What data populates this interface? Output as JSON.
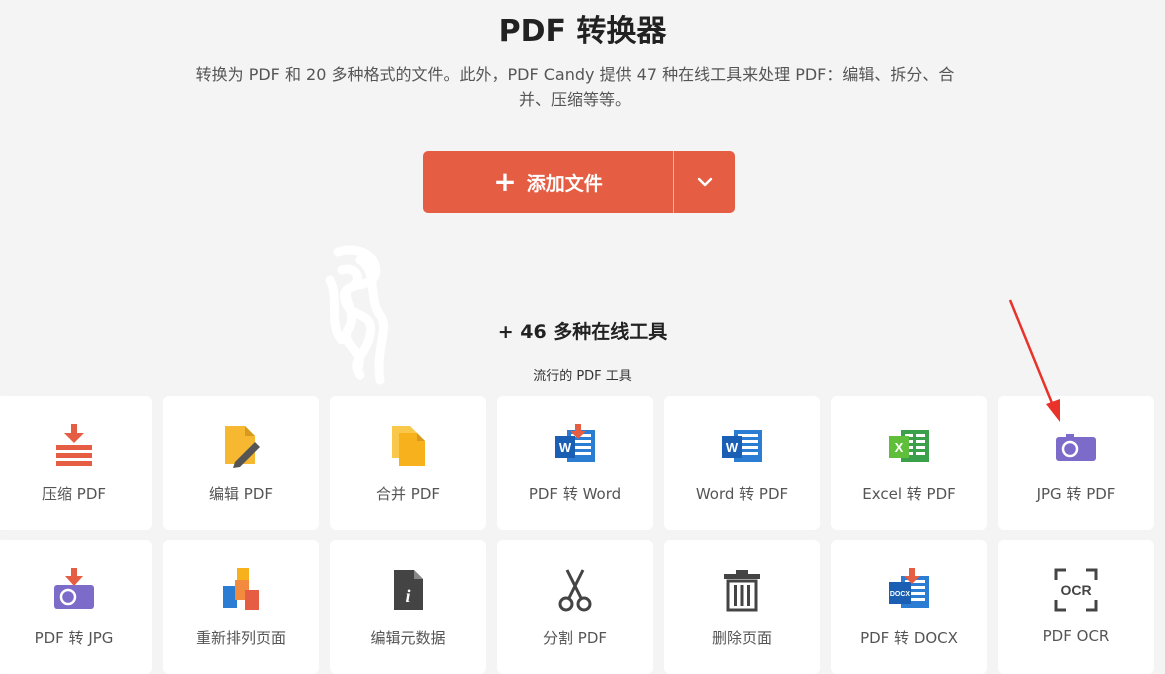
{
  "header": {
    "title": "PDF 转换器",
    "subtitle": "转换为 PDF 和 20 多种格式的文件。此外，PDF Candy 提供 47 种在线工具来处理 PDF：编辑、拆分、合并、压缩等等。"
  },
  "upload": {
    "add_label": "添加文件",
    "plus": "+"
  },
  "tools": {
    "heading": "+ 46 多种在线工具",
    "subheading": "流行的 PDF 工具",
    "items": [
      {
        "label": "压缩 PDF",
        "icon": "compress-icon"
      },
      {
        "label": "编辑 PDF",
        "icon": "edit-icon"
      },
      {
        "label": "合并 PDF",
        "icon": "merge-icon"
      },
      {
        "label": "PDF 转 Word",
        "icon": "word-icon"
      },
      {
        "label": "Word 转 PDF",
        "icon": "word-icon"
      },
      {
        "label": "Excel 转 PDF",
        "icon": "excel-icon"
      },
      {
        "label": "JPG 转 PDF",
        "icon": "camera-icon"
      },
      {
        "label": "PDF 转 JPG",
        "icon": "camera-download-icon"
      },
      {
        "label": "重新排列页面",
        "icon": "rearrange-icon"
      },
      {
        "label": "编辑元数据",
        "icon": "info-file-icon"
      },
      {
        "label": "分割 PDF",
        "icon": "scissors-icon"
      },
      {
        "label": "删除页面",
        "icon": "trash-icon"
      },
      {
        "label": "PDF 转 DOCX",
        "icon": "docx-icon"
      },
      {
        "label": "PDF OCR",
        "icon": "ocr-icon"
      }
    ]
  },
  "colors": {
    "accent": "#e55e44",
    "background": "#f4f4f4",
    "annotation_arrow": "#e8322a"
  }
}
